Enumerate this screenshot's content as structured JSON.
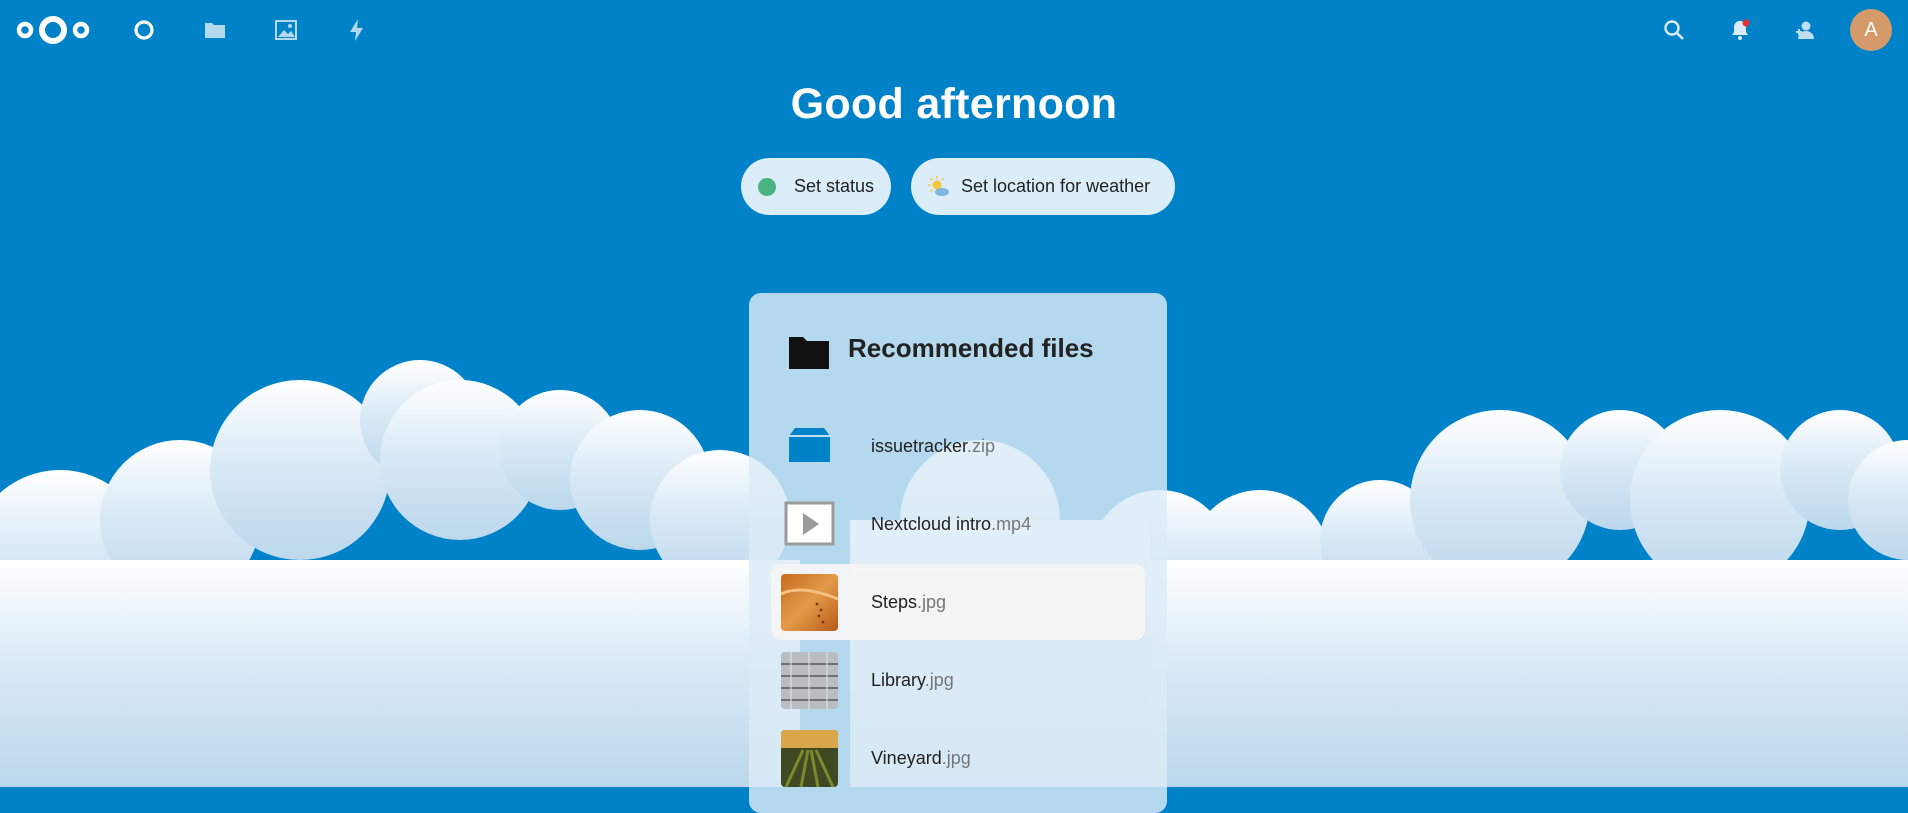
{
  "header": {
    "nav": [
      {
        "name": "dashboard-icon"
      },
      {
        "name": "files-icon"
      },
      {
        "name": "photos-icon"
      },
      {
        "name": "activity-icon"
      }
    ],
    "right": [
      {
        "name": "search-icon"
      },
      {
        "name": "notifications-icon"
      },
      {
        "name": "contacts-icon"
      }
    ],
    "avatar_letter": "A",
    "avatar_color": "#d49a6a"
  },
  "greeting": "Good afternoon",
  "status": {
    "set_status_label": "Set status",
    "status_color": "#49b382",
    "weather_label": "Set location for weather"
  },
  "recommended": {
    "title": "Recommended files",
    "files": [
      {
        "name": "issuetracker",
        "ext": ".zip",
        "icon": "package-icon"
      },
      {
        "name": "Nextcloud intro",
        "ext": ".mp4",
        "icon": "video-icon"
      },
      {
        "name": "Steps",
        "ext": ".jpg",
        "icon": "image-thumb"
      },
      {
        "name": "Library",
        "ext": ".jpg",
        "icon": "image-thumb"
      },
      {
        "name": "Vineyard",
        "ext": ".jpg",
        "icon": "image-thumb"
      }
    ]
  },
  "colors": {
    "brand": "#0082c9"
  }
}
